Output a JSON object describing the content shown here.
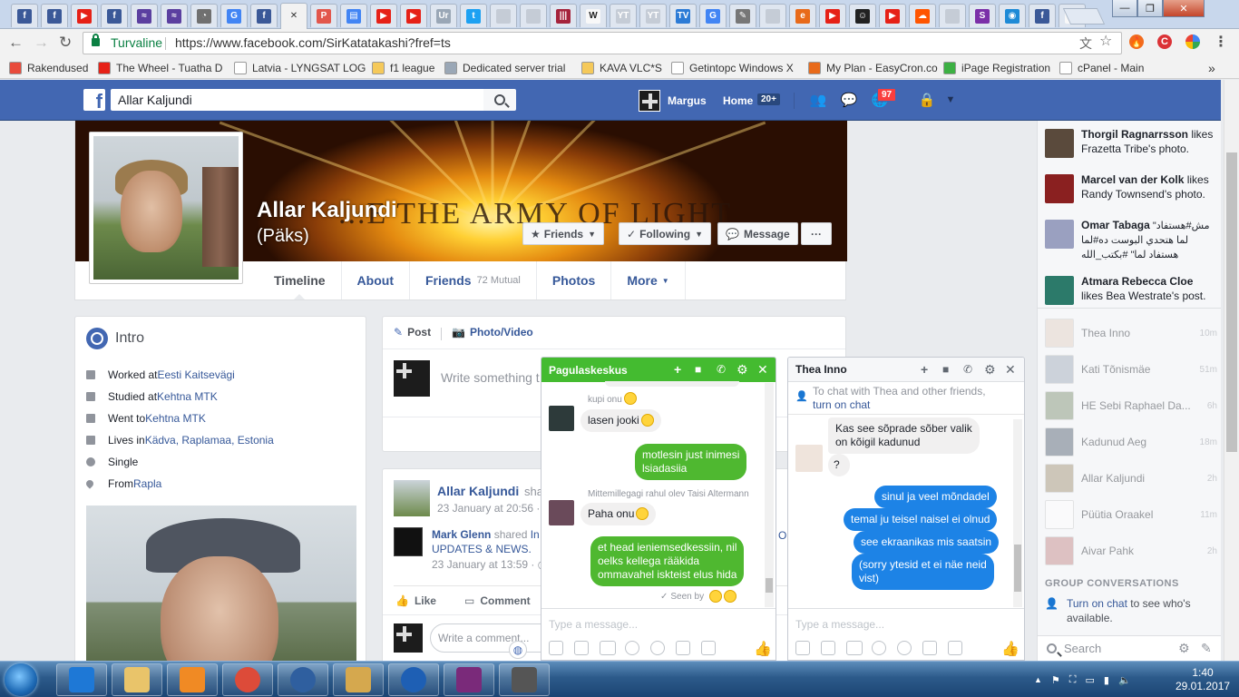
{
  "browser": {
    "tabs": [
      {
        "icon": "facebook-icon",
        "color": "#3b5998",
        "glyph": "f"
      },
      {
        "icon": "facebook-icon",
        "color": "#3b5998",
        "glyph": "f"
      },
      {
        "icon": "youtube-icon",
        "color": "#e62117",
        "glyph": "▶"
      },
      {
        "icon": "facebook-icon",
        "color": "#3b5998",
        "glyph": "f"
      },
      {
        "icon": "waveform-icon",
        "color": "#5b3fa0",
        "glyph": "≈"
      },
      {
        "icon": "waveform-icon",
        "color": "#5b3fa0",
        "glyph": "≈"
      },
      {
        "icon": "gauge-icon",
        "color": "#707070",
        "glyph": "◔"
      },
      {
        "icon": "google-icon",
        "color": "#4285f4",
        "glyph": "G"
      },
      {
        "icon": "facebook-icon",
        "color": "#3b5998",
        "glyph": "f"
      },
      {
        "icon": "close-icon",
        "color": "#f2f2f2",
        "glyph": "✕"
      },
      {
        "icon": "pdf-icon",
        "color": "#e2574c",
        "glyph": "P"
      },
      {
        "icon": "docs-icon",
        "color": "#4285f4",
        "glyph": "▤"
      },
      {
        "icon": "youtube-icon",
        "color": "#e62117",
        "glyph": "▶"
      },
      {
        "icon": "youtube-icon",
        "color": "#e62117",
        "glyph": "▶"
      },
      {
        "icon": "ur-icon",
        "color": "#9aa7b6",
        "glyph": "Ur"
      },
      {
        "icon": "twitter-icon",
        "color": "#1da1f2",
        "glyph": "t"
      },
      {
        "icon": "page-icon",
        "color": "#c5ccd6",
        "glyph": ""
      },
      {
        "icon": "page-icon",
        "color": "#c5ccd6",
        "glyph": ""
      },
      {
        "icon": "bars-icon",
        "color": "#a5233b",
        "glyph": "|||"
      },
      {
        "icon": "wikipedia-icon",
        "color": "#f8f8f8",
        "glyph": "W"
      },
      {
        "icon": "yt-icon",
        "color": "#c5ccd6",
        "glyph": "YT"
      },
      {
        "icon": "yt-icon",
        "color": "#c5ccd6",
        "glyph": "YT"
      },
      {
        "icon": "tv-kava-icon",
        "color": "#2c7bd6",
        "glyph": "TV"
      },
      {
        "icon": "google-icon",
        "color": "#4285f4",
        "glyph": "G"
      },
      {
        "icon": "pen-icon",
        "color": "#777777",
        "glyph": "✎"
      },
      {
        "icon": "page-icon",
        "color": "#c5ccd6",
        "glyph": ""
      },
      {
        "icon": "easycron-icon",
        "color": "#e86a1a",
        "glyph": "e"
      },
      {
        "icon": "youtube-icon",
        "color": "#e62117",
        "glyph": "▶"
      },
      {
        "icon": "smile-icon",
        "color": "#222222",
        "glyph": "☺"
      },
      {
        "icon": "youtube-icon",
        "color": "#e62117",
        "glyph": "▶"
      },
      {
        "icon": "soundcloud-icon",
        "color": "#f50",
        "glyph": "☁"
      },
      {
        "icon": "page-icon",
        "color": "#c5ccd6",
        "glyph": ""
      },
      {
        "icon": "s-icon",
        "color": "#7b2fa8",
        "glyph": "S"
      },
      {
        "icon": "circle-icon",
        "color": "#1e8ad6",
        "glyph": "◉"
      },
      {
        "icon": "facebook-icon",
        "color": "#3b5998",
        "glyph": "f"
      },
      {
        "icon": "wikipedia-icon",
        "color": "#f8f8f8",
        "glyph": "W"
      }
    ],
    "address": {
      "secure_label": "Turvaline",
      "url": "https://www.facebook.com/SirKatatakashi?fref=ts"
    },
    "bookmarks": [
      {
        "label": "Rakendused",
        "color": "#e84b3c"
      },
      {
        "label": "The Wheel - Tuatha D",
        "color": "#e62117"
      },
      {
        "label": "Latvia - LYNGSAT LOG",
        "color": "#ffffff"
      },
      {
        "label": "f1 league",
        "color": "#f5c95a"
      },
      {
        "label": "Dedicated server trial",
        "color": "#9aa7b6"
      },
      {
        "label": "KAVA VLC*S",
        "color": "#f5c95a"
      },
      {
        "label": "Getintopc Windows X",
        "color": "#ffffff"
      },
      {
        "label": "My Plan - EasyCron.com",
        "color": "#e86a1a"
      },
      {
        "label": "iPage Registration",
        "color": "#3cb043"
      },
      {
        "label": "cPanel - Main",
        "color": "#ffffff"
      }
    ],
    "more_bookmarks": "»"
  },
  "fb": {
    "search_value": "Allar Kaljundi",
    "user_name": "Margus",
    "home_label": "Home",
    "home_count": "20+",
    "notif_count": "97"
  },
  "profile": {
    "name": "Allar Kaljundi",
    "nickname": "(Päks)",
    "cover_text": "...E THE ARMY OF LIGHT",
    "buttons": {
      "friends": "Friends",
      "following": "Following",
      "message": "Message",
      "more": "···"
    },
    "tabs": [
      {
        "label": "Timeline"
      },
      {
        "label": "About"
      },
      {
        "label": "Friends",
        "extra": "72 Mutual"
      },
      {
        "label": "Photos"
      },
      {
        "label": "More"
      }
    ]
  },
  "intro": {
    "title": "Intro",
    "rows": [
      {
        "text": "Worked at ",
        "link": "Eesti Kaitsevägi"
      },
      {
        "text": "Studied at ",
        "link": "Kehtna MTK"
      },
      {
        "text": "Went to ",
        "link": "Kehtna MTK"
      },
      {
        "text": "Lives in ",
        "link": "Kädva, Raplamaa, Estonia"
      },
      {
        "text": "Single",
        "link": ""
      },
      {
        "text": "From ",
        "link": "Rapla"
      }
    ]
  },
  "composer": {
    "tab_post": "Post",
    "tab_photo": "Photo/Video",
    "placeholder": "Write something t"
  },
  "post": {
    "author": "Allar Kaljundi",
    "shared_suffix": "sha",
    "date": "23 January at 20:56 ·",
    "shared_author": "Mark Glenn",
    "shared_verb": " shared ",
    "shared_rest": "In",
    "shared_line2": "UPDATES & NEWS.",
    "shared_trailing": "OR",
    "shared_date": "23 January at 13:59 · ",
    "like": "Like",
    "comment": "Comment",
    "comment_placeholder": "Write a comment..."
  },
  "chat1": {
    "title": "Pagulaskeskus",
    "messages": [
      {
        "side": "in",
        "sender": "kupi onu",
        "text": "lasen jooki",
        "emoji": true
      },
      {
        "side": "out",
        "text1": "motlesin just inimesi",
        "text2": "lsiadasiia"
      },
      {
        "side": "in",
        "sender": "Mittemillegagi rahul olev Taisi Altermann",
        "text": "Paha onu",
        "emoji": true
      },
      {
        "side": "out",
        "text1": "et head ieniemsedkessiin, nil",
        "text2": "oelks kellega rääkida",
        "text3": "ommavahel iskteist elus hida"
      }
    ],
    "seen": "Seen by",
    "placeholder": "Type a message..."
  },
  "chat2": {
    "title": "Thea Inno",
    "notice_text": "To chat with Thea and other friends,",
    "notice_link": "turn on chat",
    "incoming": [
      "Kas see sõprade sõber valik",
      "on kõigil kadunud",
      "?"
    ],
    "outgoing": [
      "sinul ja veel mõndadel",
      "temal ju teisel naisel ei olnud",
      "see ekraanikas mis saatsin",
      "(sorry ytesid et ei näe neid",
      "vist)"
    ],
    "placeholder": "Type a message..."
  },
  "ticker": [
    {
      "name": "Thorgil Ragnarrsson",
      "rest": " likes Frazetta Tribe's photo.",
      "color": "#5a4a3c"
    },
    {
      "name": "Marcel van der Kolk",
      "rest": " likes Randy Townsend's photo.",
      "color": "#8a2020"
    },
    {
      "name": "Omar Tabaga",
      "rest": " \"مش#هستفاد لما هتحدي البوست ده#لما هستفاد لما\" #بكتب_الله",
      "color": "#9aa0c0"
    },
    {
      "name": "Atmara Rebecca Cloe",
      "rest": " likes Bea Westrate's post.",
      "color": "#2c7a6a"
    }
  ],
  "contacts": [
    {
      "name": "Thea Inno",
      "time": "10m",
      "color": "#e0cfc0"
    },
    {
      "name": "Kati Tõnismäe",
      "time": "51m",
      "color": "#9aa7b6"
    },
    {
      "name": "HE Sebi Raphael Da...",
      "time": "6h",
      "color": "#7a8c6c"
    },
    {
      "name": "Kadunud Aeg",
      "time": "18m",
      "color": "#4a5a6a"
    },
    {
      "name": "Allar Kaljundi",
      "time": "2h",
      "color": "#9c8c6c"
    },
    {
      "name": "Püütia Oraakel",
      "time": "11m",
      "color": "#ffffff"
    },
    {
      "name": "Aivar Pahk",
      "time": "2h",
      "color": "#c08080"
    }
  ],
  "sidebar": {
    "group_title": "GROUP CONVERSATIONS",
    "turn_on_link": "Turn on chat",
    "turn_on_rest": " to see who's available.",
    "search": "Search"
  },
  "taskbar": {
    "time": "1:40",
    "date": "29.01.2017",
    "apps": [
      {
        "icon": "ie-icon",
        "color": "#1e78d6"
      },
      {
        "icon": "explorer-icon",
        "color": "#e9c46a"
      },
      {
        "icon": "media-player-icon",
        "color": "#f08a24"
      },
      {
        "icon": "chrome-icon",
        "color": "#dd4b39"
      },
      {
        "icon": "thunderbird-icon",
        "color": "#2f5f9f"
      },
      {
        "icon": "paint-icon",
        "color": "#d5a84e"
      },
      {
        "icon": "help-icon",
        "color": "#1e5fb4"
      },
      {
        "icon": "winrar-icon",
        "color": "#7a2a7a"
      },
      {
        "icon": "microphone-icon",
        "color": "#555555"
      }
    ]
  }
}
